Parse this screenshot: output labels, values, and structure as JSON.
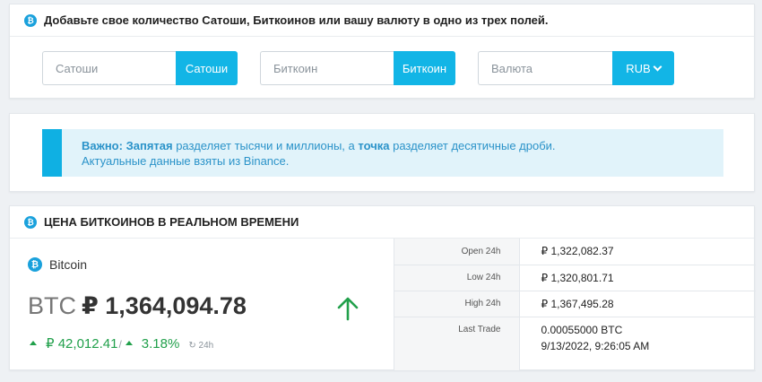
{
  "converter": {
    "heading": "Добавьте свое количество Сатоши, Биткоинов или вашу валюту в одно из трех полей.",
    "badge_symbol": "₿",
    "fields": [
      {
        "placeholder": "Сатоши",
        "button": "Сатоши"
      },
      {
        "placeholder": "Биткоин",
        "button": "Биткоин"
      },
      {
        "placeholder": "Валюта",
        "button": "RUB"
      }
    ]
  },
  "notice": {
    "important_label": "Важно:",
    "comma_word": "Запятая",
    "text_1": " разделяет тысячи и миллионы, а ",
    "dot_word": "точка",
    "text_2": " разделяет десятичные дроби.",
    "line_2": "Актуальные данные взяты из Binance."
  },
  "realtime": {
    "heading": "ЦЕНА БИТКОИНОВ В РЕАЛЬНОМ ВРЕМЕНИ",
    "coin_name": "Bitcoin",
    "currency_code": "BTC",
    "price": "₽ 1,364,094.78",
    "change_amount": "₽ 42,012.41",
    "change_separator": "/",
    "change_percent": "3.18%",
    "period": "24h",
    "direction": "up",
    "colors": {
      "accent": "#12b5e6",
      "positive": "#21a04b"
    },
    "stats": [
      {
        "label": "Open 24h",
        "value": "₽ 1,322,082.37"
      },
      {
        "label": "Low 24h",
        "value": "₽ 1,320,801.71"
      },
      {
        "label": "High 24h",
        "value": "₽ 1,367,495.28"
      },
      {
        "label": "Last Trade",
        "value": "0.00055000 BTC",
        "value_2": "9/13/2022, 9:26:05 AM"
      }
    ]
  }
}
